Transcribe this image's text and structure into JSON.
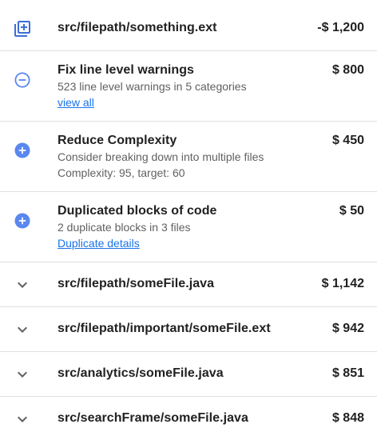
{
  "header": {
    "icon": "add-to-queue-icon",
    "path": "src/filepath/something.ext",
    "amount": "-$ 1,200"
  },
  "details": [
    {
      "icon": "remove-circle-outline-icon",
      "title": "Fix line level warnings",
      "lines": [
        "523 line level warnings in 5 categories"
      ],
      "link": "view all",
      "amount": "$ 800"
    },
    {
      "icon": "add-circle-icon",
      "title": "Reduce Complexity",
      "lines": [
        "Consider breaking down into multiple files",
        "Complexity: 95, target: 60"
      ],
      "link": "",
      "amount": "$ 450"
    },
    {
      "icon": "add-circle-icon",
      "title": "Duplicated blocks of code",
      "lines": [
        "2 duplicate blocks in 3 files"
      ],
      "link": "Duplicate details",
      "amount": "$ 50"
    }
  ],
  "files": [
    {
      "icon": "chevron-down-icon",
      "path": "src/filepath/someFile.java",
      "amount": "$ 1,142"
    },
    {
      "icon": "chevron-down-icon",
      "path": "src/filepath/important/someFile.ext",
      "amount": "$ 942"
    },
    {
      "icon": "chevron-down-icon",
      "path": "src/analytics/someFile.java",
      "amount": "$ 851"
    },
    {
      "icon": "chevron-down-icon",
      "path": "src/searchFrame/someFile.java",
      "amount": "$ 848"
    }
  ],
  "colors": {
    "accent": "#5a87f0",
    "link": "#1a73e8",
    "chevron": "#616161",
    "divider": "#e0e0e0"
  }
}
